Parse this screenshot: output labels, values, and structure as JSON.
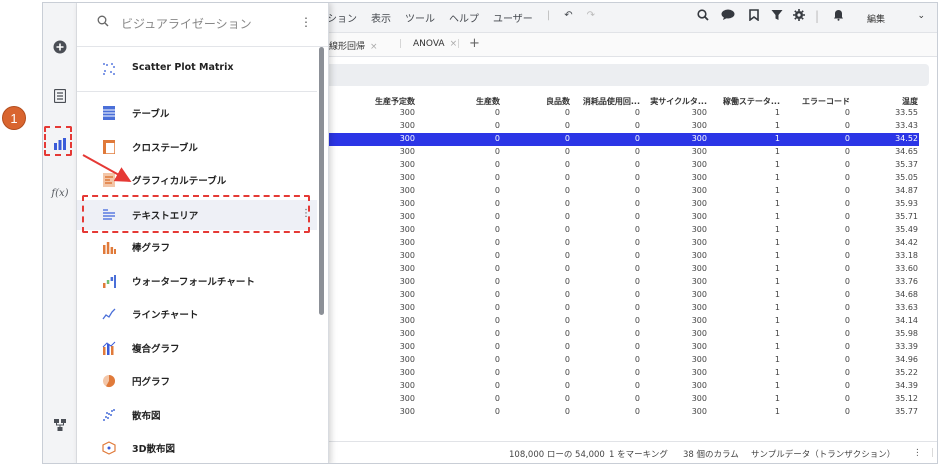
{
  "badge": "1",
  "toolbar": {
    "menu": [
      "ション",
      "表示",
      "ツール",
      "ヘルプ",
      "ユーザー"
    ],
    "mode": "編集"
  },
  "tabs": [
    {
      "label": "線形回帰"
    },
    {
      "label": "ANOVA"
    }
  ],
  "rail": {
    "fx_label": "f(x)"
  },
  "search": {
    "placeholder": "ビジュアライゼーション"
  },
  "panel_items": [
    {
      "label": "Scatter Plot Matrix",
      "icon": "scatter-matrix-icon",
      "color": "#5a7be0"
    },
    {
      "label": "テーブル",
      "icon": "table-icon",
      "color": "#4a6fd8"
    },
    {
      "label": "クロステーブル",
      "icon": "cross-table-icon",
      "color": "#e07a3a"
    },
    {
      "label": "グラフィカルテーブル",
      "icon": "graphical-table-icon",
      "color": "#e07a3a"
    },
    {
      "label": "テキストエリア",
      "icon": "text-area-icon",
      "color": "#5a7be0"
    },
    {
      "label": "棒グラフ",
      "icon": "bar-chart-icon",
      "color": "#e07a3a"
    },
    {
      "label": "ウォーターフォールチャート",
      "icon": "waterfall-chart-icon",
      "color": "#4a6fd8"
    },
    {
      "label": "ラインチャート",
      "icon": "line-chart-icon",
      "color": "#4a6fd8"
    },
    {
      "label": "複合グラフ",
      "icon": "combo-chart-icon",
      "color": "#e07a3a"
    },
    {
      "label": "円グラフ",
      "icon": "pie-chart-icon",
      "color": "#e07a3a"
    },
    {
      "label": "散布図",
      "icon": "scatter-icon",
      "color": "#4a6fd8"
    },
    {
      "label": "3D散布図",
      "icon": "scatter-3d-icon",
      "color": "#e07a3a"
    }
  ],
  "table": {
    "columns": [
      "生産予定数",
      "生産数",
      "良品数",
      "消耗品使用回...",
      "実サイクルタ...",
      "稼働ステータ...",
      "エラーコード",
      "温度"
    ],
    "selected_row": 2,
    "rows": [
      [
        "300",
        "0",
        "0",
        "0",
        "300",
        "1",
        "0",
        "33.55"
      ],
      [
        "300",
        "0",
        "0",
        "0",
        "300",
        "1",
        "0",
        "33.43"
      ],
      [
        "300",
        "0",
        "0",
        "0",
        "300",
        "1",
        "0",
        "34.52"
      ],
      [
        "300",
        "0",
        "0",
        "0",
        "300",
        "1",
        "0",
        "34.65"
      ],
      [
        "300",
        "0",
        "0",
        "0",
        "300",
        "1",
        "0",
        "35.37"
      ],
      [
        "300",
        "0",
        "0",
        "0",
        "300",
        "1",
        "0",
        "35.05"
      ],
      [
        "300",
        "0",
        "0",
        "0",
        "300",
        "1",
        "0",
        "34.87"
      ],
      [
        "300",
        "0",
        "0",
        "0",
        "300",
        "1",
        "0",
        "35.93"
      ],
      [
        "300",
        "0",
        "0",
        "0",
        "300",
        "1",
        "0",
        "35.71"
      ],
      [
        "300",
        "0",
        "0",
        "0",
        "300",
        "1",
        "0",
        "35.49"
      ],
      [
        "300",
        "0",
        "0",
        "0",
        "300",
        "1",
        "0",
        "34.42"
      ],
      [
        "300",
        "0",
        "0",
        "0",
        "300",
        "1",
        "0",
        "33.18"
      ],
      [
        "300",
        "0",
        "0",
        "0",
        "300",
        "1",
        "0",
        "33.60"
      ],
      [
        "300",
        "0",
        "0",
        "0",
        "300",
        "1",
        "0",
        "33.76"
      ],
      [
        "300",
        "0",
        "0",
        "0",
        "300",
        "1",
        "0",
        "34.68"
      ],
      [
        "300",
        "0",
        "0",
        "0",
        "300",
        "1",
        "0",
        "33.63"
      ],
      [
        "300",
        "0",
        "0",
        "0",
        "300",
        "1",
        "0",
        "34.14"
      ],
      [
        "300",
        "0",
        "0",
        "0",
        "300",
        "1",
        "0",
        "35.98"
      ],
      [
        "300",
        "0",
        "0",
        "0",
        "300",
        "1",
        "0",
        "33.39"
      ],
      [
        "300",
        "0",
        "0",
        "0",
        "300",
        "1",
        "0",
        "34.96"
      ],
      [
        "300",
        "0",
        "0",
        "0",
        "300",
        "1",
        "0",
        "35.22"
      ],
      [
        "300",
        "0",
        "0",
        "0",
        "300",
        "1",
        "0",
        "34.39"
      ],
      [
        "300",
        "0",
        "0",
        "0",
        "300",
        "1",
        "0",
        "35.12"
      ],
      [
        "300",
        "0",
        "0",
        "0",
        "300",
        "1",
        "0",
        "35.77"
      ]
    ]
  },
  "status": {
    "rows": "108,000 ローの 54,000",
    "marking": "1 をマーキング",
    "columns": "38 個のカラム",
    "source": "サンプルデータ（トランザクション）"
  },
  "colors": {
    "selection": "#2b35e6",
    "annotation": "#e53935",
    "badge": "#d9652f"
  }
}
